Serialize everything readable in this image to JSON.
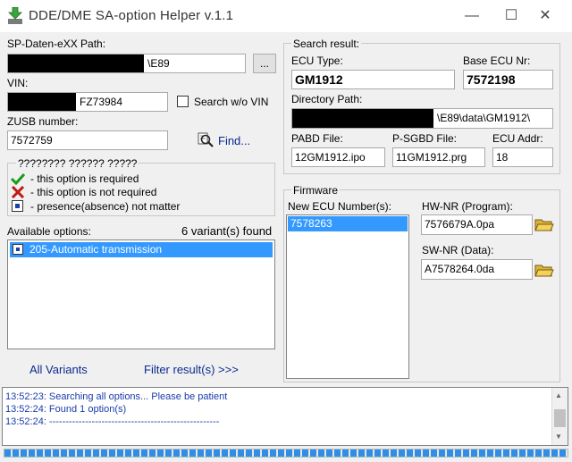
{
  "window": {
    "title": "DDE/DME SA-option Helper  v.1.1",
    "minimize": "—",
    "maximize": "☐",
    "close": "✕"
  },
  "left": {
    "sp_path_label": "SP-Daten-eXX Path:",
    "sp_path_value": "\\E89",
    "browse_label": "...",
    "vin_label": "VIN:",
    "vin_value": "FZ73984",
    "search_wo_vin_label": "Search w/o VIN",
    "zusb_label": "ZUSB number:",
    "zusb_value": "7572759",
    "find_label": "Find...",
    "legend": {
      "title": "???????? ?????? ?????",
      "required": "- this option is required",
      "not_required": "- this option is not required",
      "not_matter": "- presence(absence) not matter"
    },
    "available_options_label": "Available options:",
    "variants_found": "6 variant(s) found",
    "options": [
      "205-Automatic transmission"
    ],
    "all_variants_label": "All Variants",
    "filter_result_label": "Filter result(s) >>>"
  },
  "search_result": {
    "group_title": "Search result:",
    "ecu_type_label": "ECU Type:",
    "ecu_type_value": "GM1912",
    "base_ecu_label": "Base ECU Nr:",
    "base_ecu_value": "7572198",
    "directory_label": "Directory Path:",
    "directory_value": "\\E89\\data\\GM1912\\",
    "pabd_label": "PABD File:",
    "pabd_value": "12GM1912.ipo",
    "psgbd_label": "P-SGBD File:",
    "psgbd_value": "11GM1912.prg",
    "ecu_addr_label": "ECU Addr:",
    "ecu_addr_value": "18"
  },
  "firmware": {
    "group_title": "Firmware",
    "new_ecu_label": "New ECU Number(s):",
    "new_ecu_items": [
      "7578263"
    ],
    "hw_label": "HW-NR (Program):",
    "hw_value": "7576679A.0pa",
    "sw_label": "SW-NR (Data):",
    "sw_value": "A7578264.0da"
  },
  "log": [
    "13:52:23:  Searching all options... Please be patient",
    "13:52:24:  Found 1 option(s)",
    "13:52:24:  ----------------------------------------------------"
  ],
  "progress": 1.0,
  "colors": {
    "selection": "#3399ff",
    "link": "#0a2a8f",
    "log_text": "#1a3caa"
  }
}
